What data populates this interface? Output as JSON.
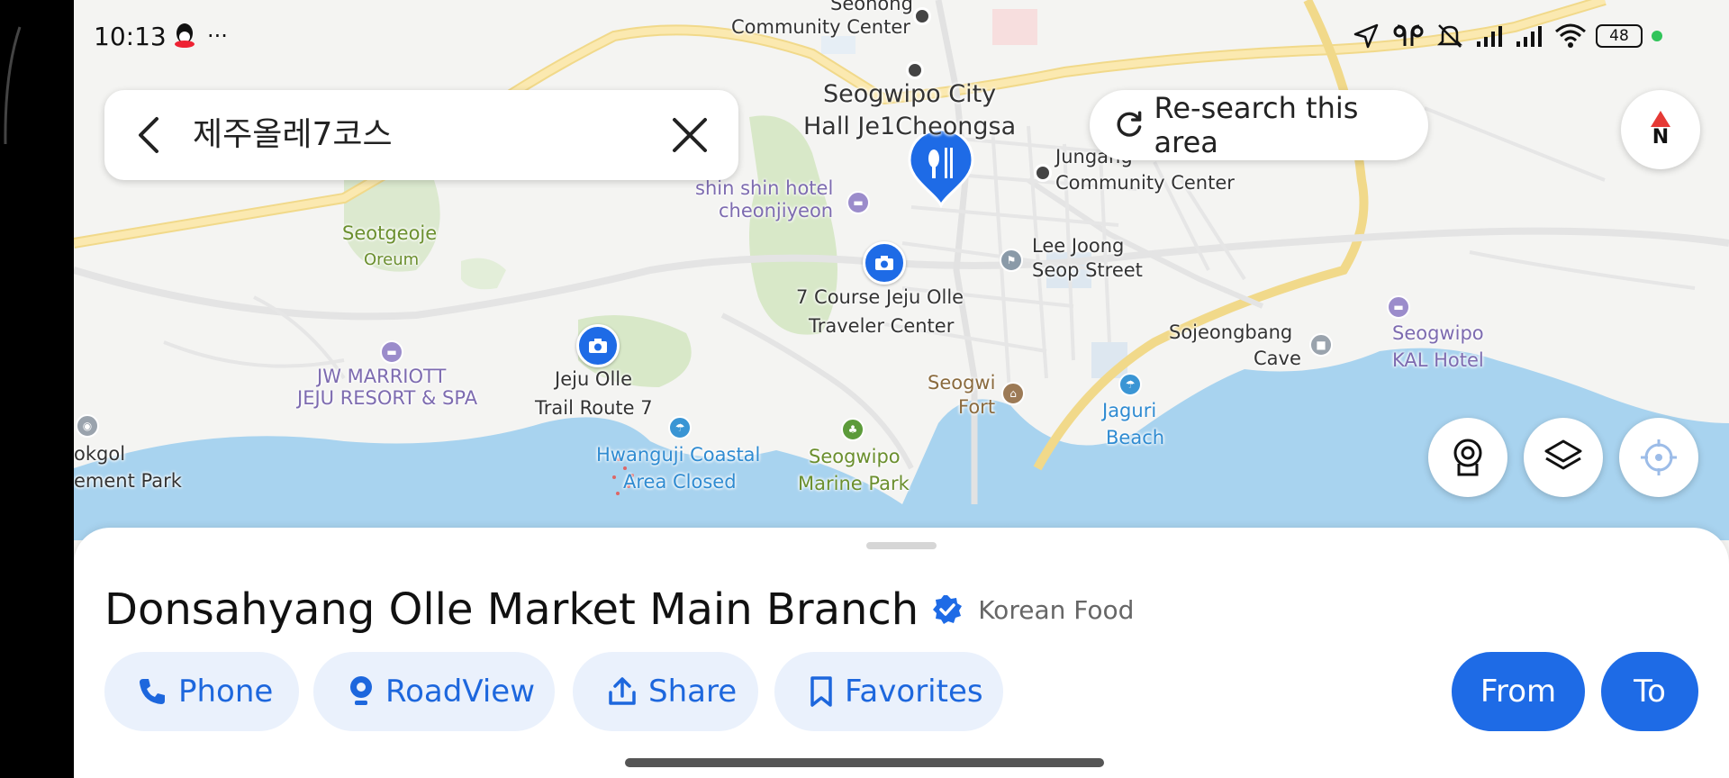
{
  "status_bar": {
    "time": "10:13",
    "more": "···",
    "battery": "48"
  },
  "search": {
    "query": "제주올레7코스"
  },
  "research_label": "Re-search this area",
  "compass_label": "N",
  "map_labels": {
    "seongsan": "Seohong",
    "community_center_1": "Community Center",
    "city_hall_1": "Seogwipo City",
    "city_hall_2": "Hall Je1Cheongsa",
    "jungang_1": "Jungang",
    "jungang_2": "Community Center",
    "shinshin_1": "shin shin hotel",
    "shinshin_2": "cheonjiyeon",
    "seotgeoje": "Seotgeoje",
    "oreum": "Oreum",
    "lee_joong_1": "Lee Joong",
    "lee_joong_2": "Seop Street",
    "olle_center_1": "7 Course Jeju Olle",
    "olle_center_2": "Traveler Center",
    "sojeongbang_1": "Sojeongbang",
    "sojeongbang_2": "Cave",
    "kal_1": "Seogwipo",
    "kal_2": "KAL Hotel",
    "marriott_1": "JW MARRIOTT",
    "marriott_2": "JEJU RESORT & SPA",
    "trail_1": "Jeju Olle",
    "trail_2": "Trail Route 7",
    "fort_1": "Seogwi",
    "fort_2": "Fort",
    "jaguri_1": "Jaguri",
    "jaguri_2": "Beach",
    "hwanguji_1": "Hwanguji Coastal",
    "hwanguji_2": "Area Closed",
    "marine_1": "Seogwipo",
    "marine_2": "Marine Park",
    "okgol_1": "okgol",
    "okgol_2": "ement Park"
  },
  "place": {
    "name": "Donsahyang Olle Market Main Branch",
    "category": "Korean Food"
  },
  "actions": {
    "phone": "Phone",
    "roadview": "RoadView",
    "share": "Share",
    "favorites": "Favorites",
    "from": "From",
    "to": "To"
  },
  "colors": {
    "accent": "#1e6be6",
    "water": "#a8d3ef",
    "park": "#d8e8c8"
  }
}
